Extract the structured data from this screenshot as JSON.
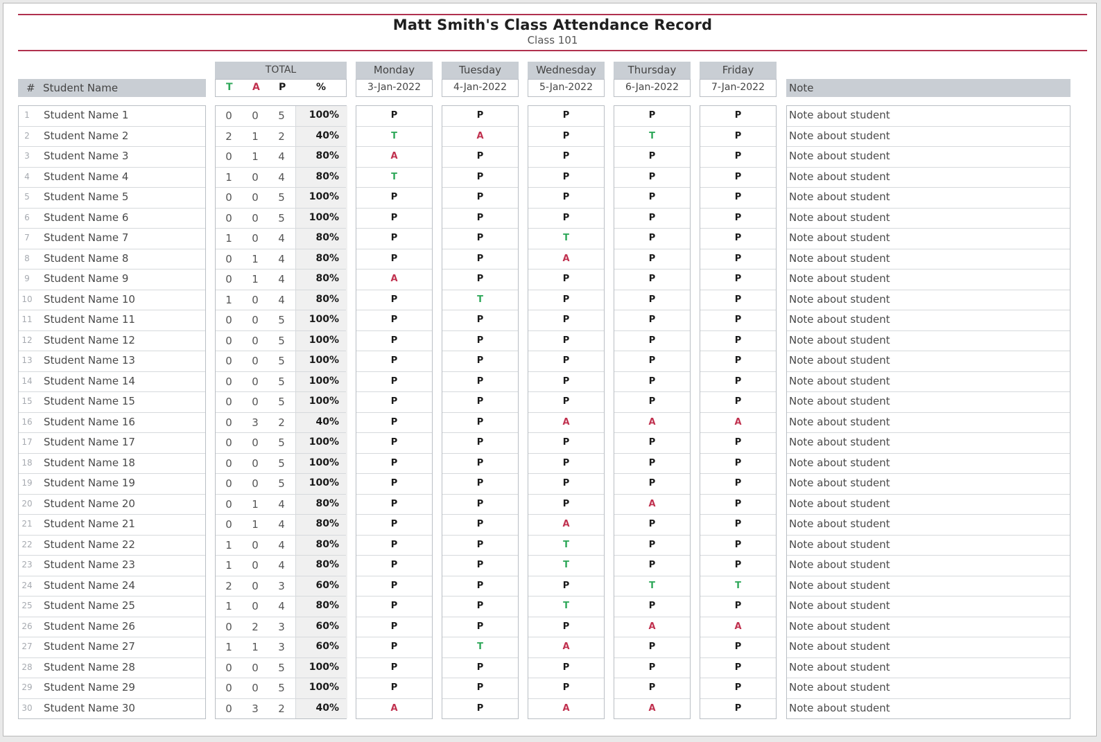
{
  "header": {
    "title": "Matt Smith's Class Attendance Record",
    "subtitle": "Class 101"
  },
  "columns": {
    "number": "#",
    "student_name": "Student Name",
    "total": "TOTAL",
    "tardy": "T",
    "absent": "A",
    "present": "P",
    "percent": "%",
    "note": "Note"
  },
  "days": [
    {
      "name": "Monday",
      "date": "3-Jan-2022"
    },
    {
      "name": "Tuesday",
      "date": "4-Jan-2022"
    },
    {
      "name": "Wednesday",
      "date": "5-Jan-2022"
    },
    {
      "name": "Thursday",
      "date": "6-Jan-2022"
    },
    {
      "name": "Friday",
      "date": "7-Jan-2022"
    }
  ],
  "colors": {
    "tardy": "#2fa85a",
    "absent": "#c0304e",
    "present": "#1a1a1a",
    "accent": "#b0304e"
  },
  "students": [
    {
      "num": "1",
      "name": "Student Name 1",
      "t": "0",
      "a": "0",
      "p": "5",
      "pct": "100%",
      "days": [
        "P",
        "P",
        "P",
        "P",
        "P"
      ],
      "note": "Note about student"
    },
    {
      "num": "2",
      "name": "Student Name 2",
      "t": "2",
      "a": "1",
      "p": "2",
      "pct": "40%",
      "days": [
        "T",
        "A",
        "P",
        "T",
        "P"
      ],
      "note": "Note about student"
    },
    {
      "num": "3",
      "name": "Student Name 3",
      "t": "0",
      "a": "1",
      "p": "4",
      "pct": "80%",
      "days": [
        "A",
        "P",
        "P",
        "P",
        "P"
      ],
      "note": "Note about student"
    },
    {
      "num": "4",
      "name": "Student Name 4",
      "t": "1",
      "a": "0",
      "p": "4",
      "pct": "80%",
      "days": [
        "T",
        "P",
        "P",
        "P",
        "P"
      ],
      "note": "Note about student"
    },
    {
      "num": "5",
      "name": "Student Name 5",
      "t": "0",
      "a": "0",
      "p": "5",
      "pct": "100%",
      "days": [
        "P",
        "P",
        "P",
        "P",
        "P"
      ],
      "note": "Note about student"
    },
    {
      "num": "6",
      "name": "Student Name 6",
      "t": "0",
      "a": "0",
      "p": "5",
      "pct": "100%",
      "days": [
        "P",
        "P",
        "P",
        "P",
        "P"
      ],
      "note": "Note about student"
    },
    {
      "num": "7",
      "name": "Student Name 7",
      "t": "1",
      "a": "0",
      "p": "4",
      "pct": "80%",
      "days": [
        "P",
        "P",
        "T",
        "P",
        "P"
      ],
      "note": "Note about student"
    },
    {
      "num": "8",
      "name": "Student Name 8",
      "t": "0",
      "a": "1",
      "p": "4",
      "pct": "80%",
      "days": [
        "P",
        "P",
        "A",
        "P",
        "P"
      ],
      "note": "Note about student"
    },
    {
      "num": "9",
      "name": "Student Name 9",
      "t": "0",
      "a": "1",
      "p": "4",
      "pct": "80%",
      "days": [
        "A",
        "P",
        "P",
        "P",
        "P"
      ],
      "note": "Note about student"
    },
    {
      "num": "10",
      "name": "Student Name 10",
      "t": "1",
      "a": "0",
      "p": "4",
      "pct": "80%",
      "days": [
        "P",
        "T",
        "P",
        "P",
        "P"
      ],
      "note": "Note about student"
    },
    {
      "num": "11",
      "name": "Student Name 11",
      "t": "0",
      "a": "0",
      "p": "5",
      "pct": "100%",
      "days": [
        "P",
        "P",
        "P",
        "P",
        "P"
      ],
      "note": "Note about student"
    },
    {
      "num": "12",
      "name": "Student Name 12",
      "t": "0",
      "a": "0",
      "p": "5",
      "pct": "100%",
      "days": [
        "P",
        "P",
        "P",
        "P",
        "P"
      ],
      "note": "Note about student"
    },
    {
      "num": "13",
      "name": "Student Name 13",
      "t": "0",
      "a": "0",
      "p": "5",
      "pct": "100%",
      "days": [
        "P",
        "P",
        "P",
        "P",
        "P"
      ],
      "note": "Note about student"
    },
    {
      "num": "14",
      "name": "Student Name 14",
      "t": "0",
      "a": "0",
      "p": "5",
      "pct": "100%",
      "days": [
        "P",
        "P",
        "P",
        "P",
        "P"
      ],
      "note": "Note about student"
    },
    {
      "num": "15",
      "name": "Student Name 15",
      "t": "0",
      "a": "0",
      "p": "5",
      "pct": "100%",
      "days": [
        "P",
        "P",
        "P",
        "P",
        "P"
      ],
      "note": "Note about student"
    },
    {
      "num": "16",
      "name": "Student Name 16",
      "t": "0",
      "a": "3",
      "p": "2",
      "pct": "40%",
      "days": [
        "P",
        "P",
        "A",
        "A",
        "A"
      ],
      "note": "Note about student"
    },
    {
      "num": "17",
      "name": "Student Name 17",
      "t": "0",
      "a": "0",
      "p": "5",
      "pct": "100%",
      "days": [
        "P",
        "P",
        "P",
        "P",
        "P"
      ],
      "note": "Note about student"
    },
    {
      "num": "18",
      "name": "Student Name 18",
      "t": "0",
      "a": "0",
      "p": "5",
      "pct": "100%",
      "days": [
        "P",
        "P",
        "P",
        "P",
        "P"
      ],
      "note": "Note about student"
    },
    {
      "num": "19",
      "name": "Student Name 19",
      "t": "0",
      "a": "0",
      "p": "5",
      "pct": "100%",
      "days": [
        "P",
        "P",
        "P",
        "P",
        "P"
      ],
      "note": "Note about student"
    },
    {
      "num": "20",
      "name": "Student Name 20",
      "t": "0",
      "a": "1",
      "p": "4",
      "pct": "80%",
      "days": [
        "P",
        "P",
        "P",
        "A",
        "P"
      ],
      "note": "Note about student"
    },
    {
      "num": "21",
      "name": "Student Name 21",
      "t": "0",
      "a": "1",
      "p": "4",
      "pct": "80%",
      "days": [
        "P",
        "P",
        "A",
        "P",
        "P"
      ],
      "note": "Note about student"
    },
    {
      "num": "22",
      "name": "Student Name 22",
      "t": "1",
      "a": "0",
      "p": "4",
      "pct": "80%",
      "days": [
        "P",
        "P",
        "T",
        "P",
        "P"
      ],
      "note": "Note about student"
    },
    {
      "num": "23",
      "name": "Student Name 23",
      "t": "1",
      "a": "0",
      "p": "4",
      "pct": "80%",
      "days": [
        "P",
        "P",
        "T",
        "P",
        "P"
      ],
      "note": "Note about student"
    },
    {
      "num": "24",
      "name": "Student Name 24",
      "t": "2",
      "a": "0",
      "p": "3",
      "pct": "60%",
      "days": [
        "P",
        "P",
        "P",
        "T",
        "T"
      ],
      "note": "Note about student"
    },
    {
      "num": "25",
      "name": "Student Name 25",
      "t": "1",
      "a": "0",
      "p": "4",
      "pct": "80%",
      "days": [
        "P",
        "P",
        "T",
        "P",
        "P"
      ],
      "note": "Note about student"
    },
    {
      "num": "26",
      "name": "Student Name 26",
      "t": "0",
      "a": "2",
      "p": "3",
      "pct": "60%",
      "days": [
        "P",
        "P",
        "P",
        "A",
        "A"
      ],
      "note": "Note about student"
    },
    {
      "num": "27",
      "name": "Student Name 27",
      "t": "1",
      "a": "1",
      "p": "3",
      "pct": "60%",
      "days": [
        "P",
        "T",
        "A",
        "P",
        "P"
      ],
      "note": "Note about student"
    },
    {
      "num": "28",
      "name": "Student Name 28",
      "t": "0",
      "a": "0",
      "p": "5",
      "pct": "100%",
      "days": [
        "P",
        "P",
        "P",
        "P",
        "P"
      ],
      "note": "Note about student"
    },
    {
      "num": "29",
      "name": "Student Name 29",
      "t": "0",
      "a": "0",
      "p": "5",
      "pct": "100%",
      "days": [
        "P",
        "P",
        "P",
        "P",
        "P"
      ],
      "note": "Note about student"
    },
    {
      "num": "30",
      "name": "Student Name 30",
      "t": "0",
      "a": "3",
      "p": "2",
      "pct": "40%",
      "days": [
        "A",
        "P",
        "A",
        "A",
        "P"
      ],
      "note": "Note about student"
    }
  ]
}
